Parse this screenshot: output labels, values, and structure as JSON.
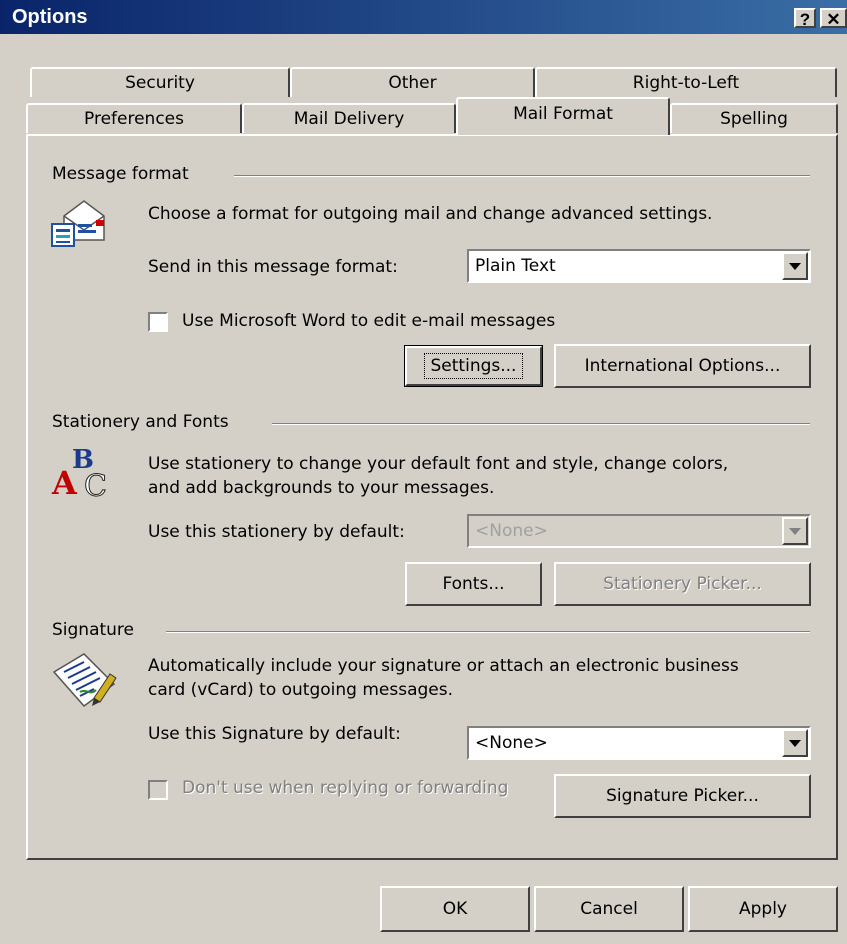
{
  "window": {
    "title": "Options",
    "help_button": "?",
    "close_button": "✕"
  },
  "tabs": {
    "row_back": [
      "Security",
      "Other",
      "Right-to-Left"
    ],
    "row_front": [
      "Preferences",
      "Mail Delivery",
      "Mail Format",
      "Spelling"
    ],
    "active": "Mail Format"
  },
  "message_format": {
    "section_label": "Message format",
    "description": "Choose a format for outgoing mail and change advanced settings.",
    "send_format_label": "Send in this message format:",
    "send_format_value": "Plain Text",
    "use_word_label": "Use Microsoft Word to edit e-mail messages",
    "use_word_checked": false,
    "settings_button": "Settings...",
    "international_button": "International Options..."
  },
  "stationery": {
    "section_label": "Stationery and Fonts",
    "description_line1": "Use stationery to change your default font and style, change colors,",
    "description_line2": "and add backgrounds to your messages.",
    "default_label": "Use this stationery by default:",
    "default_value": "<None>",
    "fonts_button": "Fonts...",
    "picker_button": "Stationery Picker..."
  },
  "signature": {
    "section_label": "Signature",
    "description_line1": "Automatically include your signature or attach an electronic business",
    "description_line2": "card (vCard) to outgoing messages.",
    "default_label": "Use this Signature by default:",
    "default_value": "<None>",
    "dont_use_label": "Don't use when replying or forwarding",
    "dont_use_checked": false,
    "picker_button": "Signature Picker..."
  },
  "footer": {
    "ok_button": "OK",
    "cancel_button": "Cancel",
    "apply_button": "Apply"
  },
  "colors": {
    "titlebar_start": "#0a246a",
    "titlebar_end": "#3a6ea5",
    "face": "#d4d0c8"
  }
}
